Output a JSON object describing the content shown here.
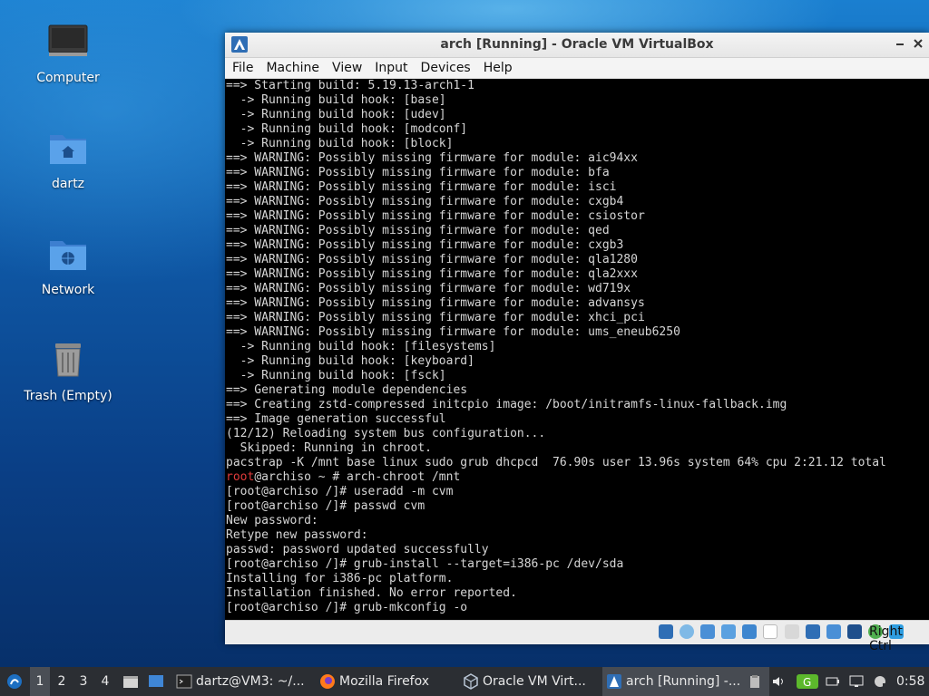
{
  "desktop": {
    "icons": [
      {
        "label": "Computer",
        "icon": "computer-icon"
      },
      {
        "label": "dartz",
        "icon": "home-folder-icon"
      },
      {
        "label": "Network",
        "icon": "network-folder-icon"
      },
      {
        "label": "Trash (Empty)",
        "icon": "trash-icon"
      }
    ]
  },
  "window": {
    "title": "arch [Running] - Oracle VM VirtualBox",
    "menu": [
      "File",
      "Machine",
      "View",
      "Input",
      "Devices",
      "Help"
    ],
    "terminal_lines": [
      "==> Starting build: 5.19.13-arch1-1",
      "  -> Running build hook: [base]",
      "  -> Running build hook: [udev]",
      "  -> Running build hook: [modconf]",
      "  -> Running build hook: [block]",
      "==> WARNING: Possibly missing firmware for module: aic94xx",
      "==> WARNING: Possibly missing firmware for module: bfa",
      "==> WARNING: Possibly missing firmware for module: isci",
      "==> WARNING: Possibly missing firmware for module: cxgb4",
      "==> WARNING: Possibly missing firmware for module: csiostor",
      "==> WARNING: Possibly missing firmware for module: qed",
      "==> WARNING: Possibly missing firmware for module: cxgb3",
      "==> WARNING: Possibly missing firmware for module: qla1280",
      "==> WARNING: Possibly missing firmware for module: qla2xxx",
      "==> WARNING: Possibly missing firmware for module: wd719x",
      "==> WARNING: Possibly missing firmware for module: advansys",
      "==> WARNING: Possibly missing firmware for module: xhci_pci",
      "==> WARNING: Possibly missing firmware for module: ums_eneub6250",
      "  -> Running build hook: [filesystems]",
      "  -> Running build hook: [keyboard]",
      "  -> Running build hook: [fsck]",
      "==> Generating module dependencies",
      "==> Creating zstd-compressed initcpio image: /boot/initramfs-linux-fallback.img",
      "==> Image generation successful",
      "(12/12) Reloading system bus configuration...",
      "  Skipped: Running in chroot.",
      "pacstrap -K /mnt base linux sudo grub dhcpcd  76.90s user 13.96s system 64% cpu 2:21.12 total",
      "",
      "[root@archiso /]# useradd -m cvm",
      "[root@archiso /]# passwd cvm",
      "New password:",
      "Retype new password:",
      "passwd: password updated successfully",
      "[root@archiso /]# grub-install --target=i386-pc /dev/sda",
      "Installing for i386-pc platform.",
      "Installation finished. No error reported.",
      "[root@archiso /]# grub-mkconfig -o"
    ],
    "root_prompt_user": "root",
    "root_prompt_rest": "@archiso ~ # arch-chroot /mnt",
    "host_key": "Right Ctrl"
  },
  "taskbar": {
    "workspaces": [
      "1",
      "2",
      "3",
      "4"
    ],
    "tasks": [
      {
        "label": "dartz@VM3: ~/...",
        "icon": "terminal-icon"
      },
      {
        "label": "Mozilla Firefox",
        "icon": "firefox-icon"
      },
      {
        "label": "Oracle VM Virt...",
        "icon": "virtualbox-icon"
      },
      {
        "label": "arch [Running] -...",
        "icon": "virtualbox-vm-icon"
      }
    ],
    "clock": "0:58"
  },
  "colors": {
    "prompt_red": "#e23b3b",
    "terminal_bg": "#000000",
    "terminal_fg": "#d6d6d6",
    "taskbar_bg": "#2b2e33"
  }
}
